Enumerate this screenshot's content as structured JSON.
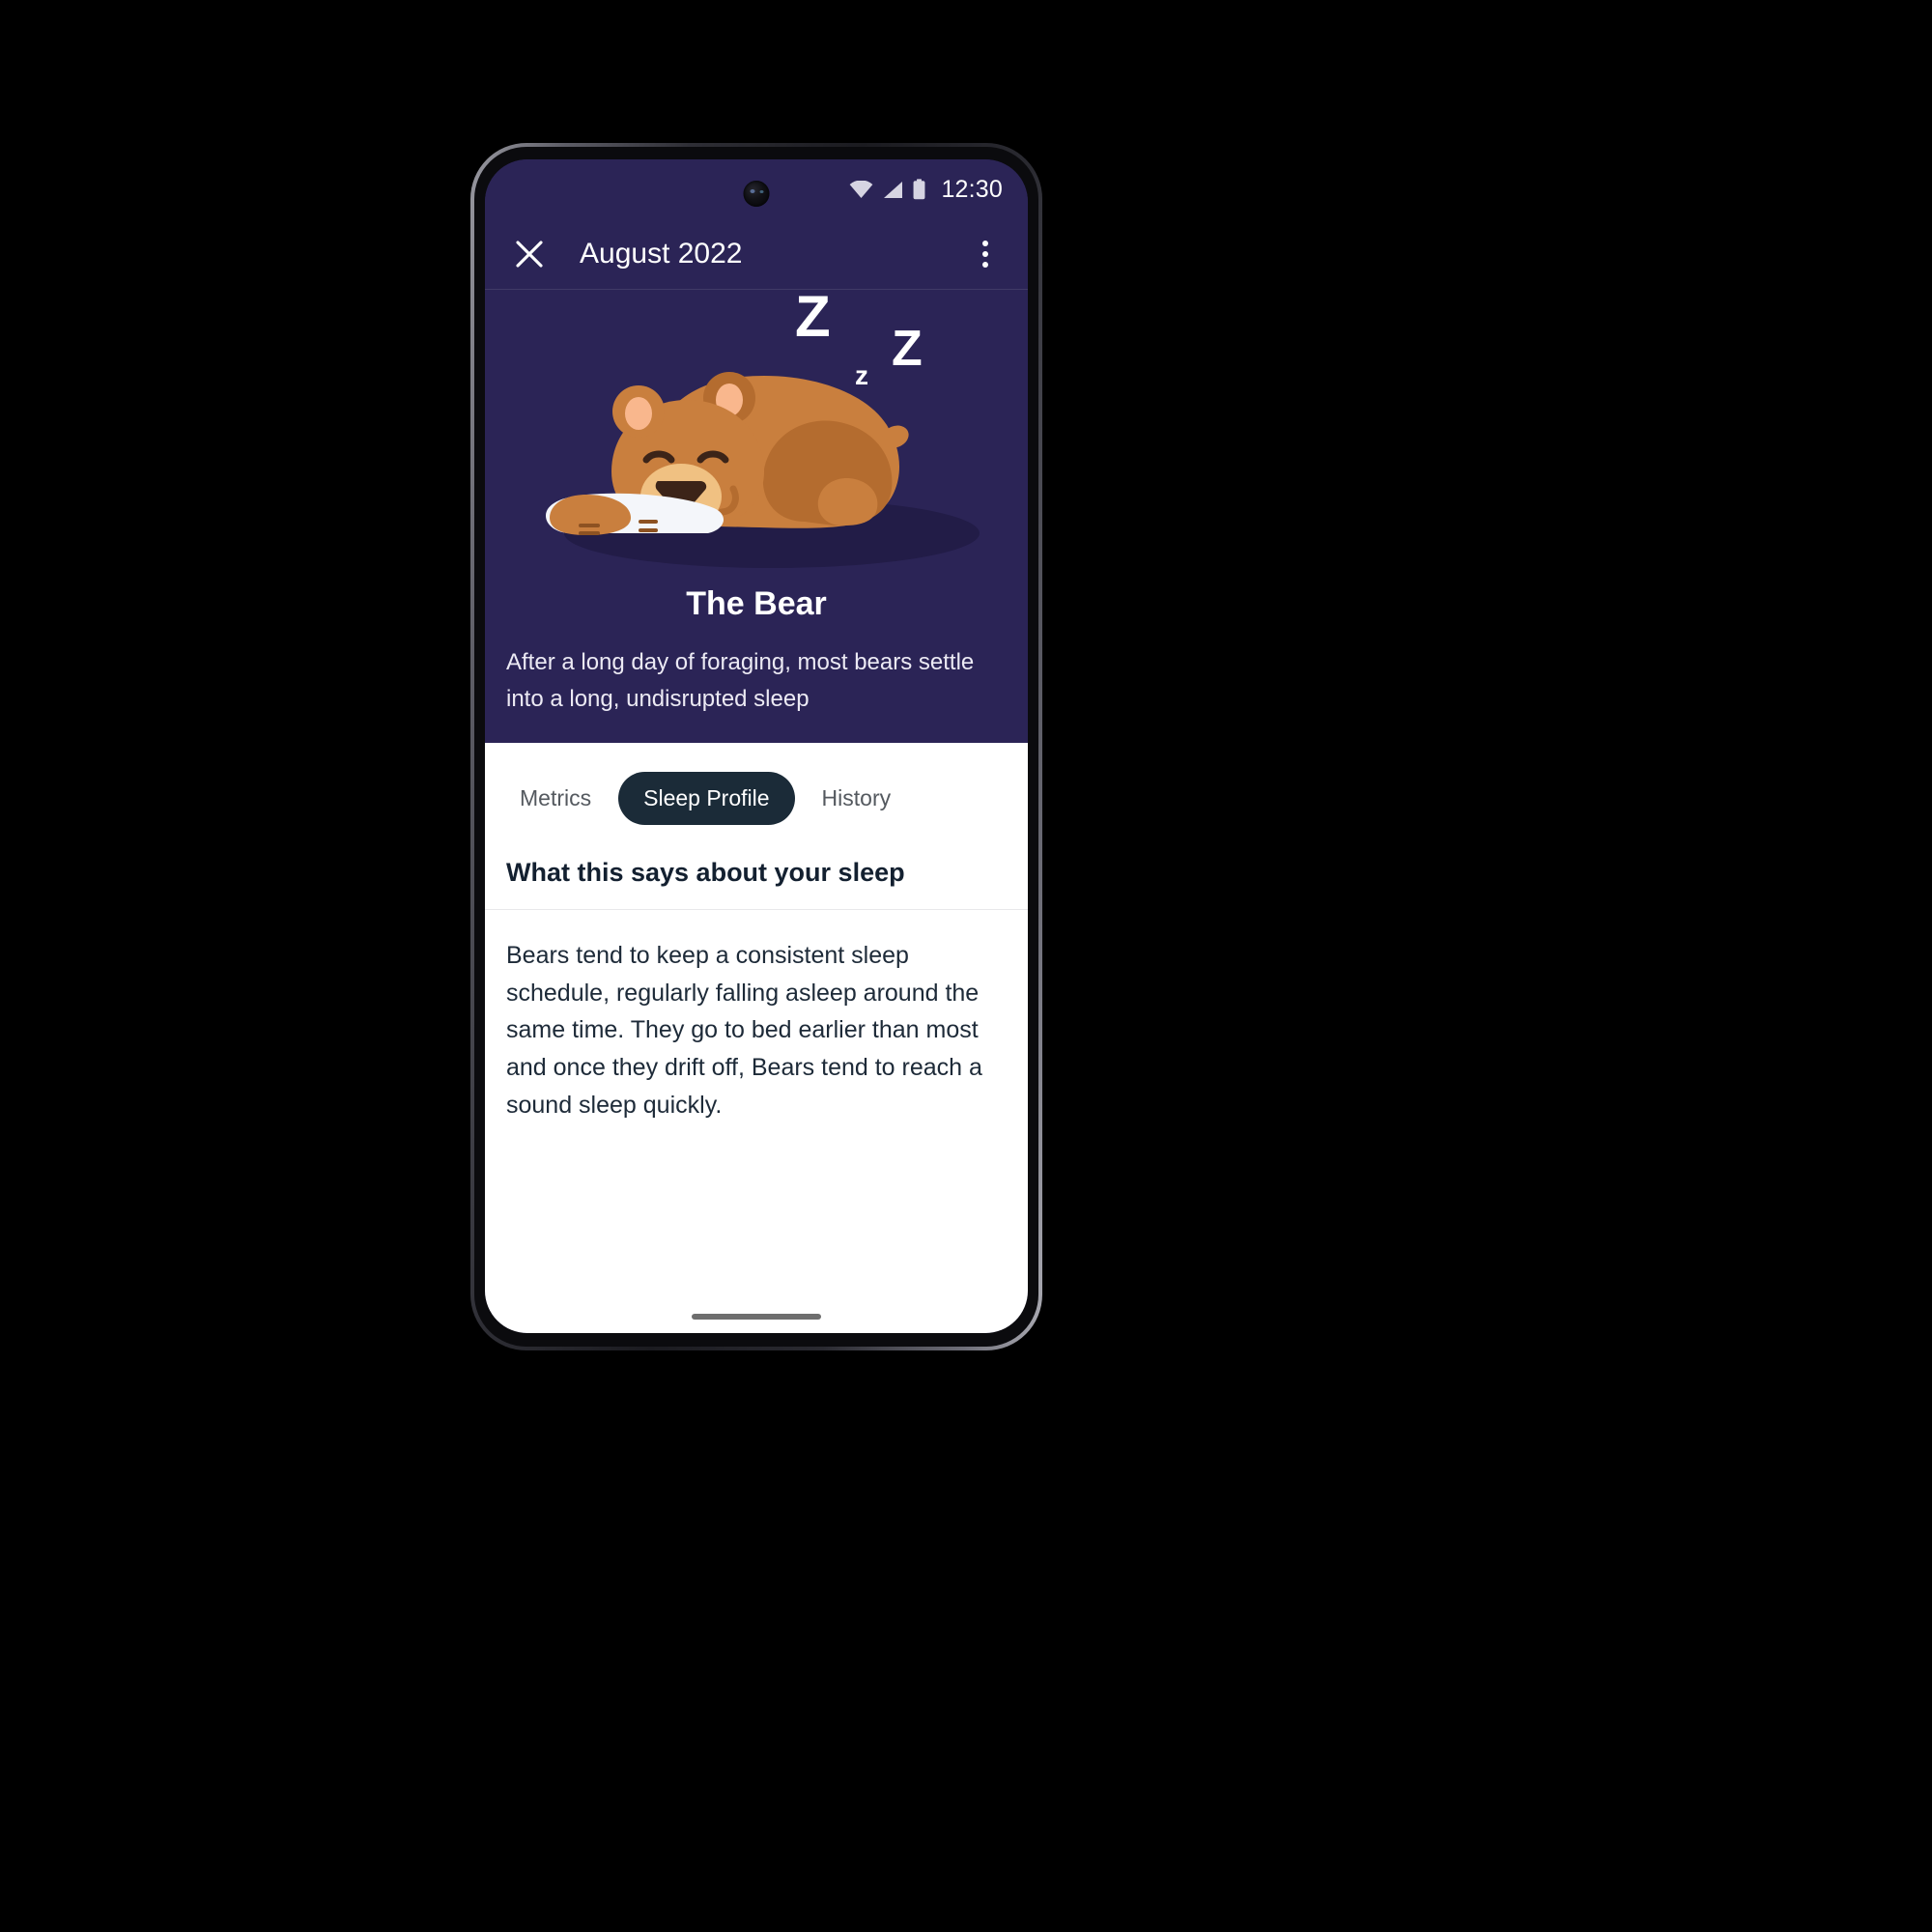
{
  "status_bar": {
    "time": "12:30",
    "icons": [
      "wifi-icon",
      "cellular-signal-icon",
      "battery-icon"
    ]
  },
  "app_bar": {
    "close_icon": "close-icon",
    "title": "August 2022",
    "overflow_icon": "more-vertical-icon"
  },
  "hero": {
    "illustration": "sleeping-bear-illustration",
    "sleep_marks": [
      "Z",
      "z",
      "Z"
    ],
    "title": "The Bear",
    "description": "After a long day of foraging, most bears settle into a long, undisrupted sleep",
    "background_color": "#2b2456"
  },
  "tabs": [
    {
      "label": "Metrics",
      "active": false
    },
    {
      "label": "Sleep Profile",
      "active": true
    },
    {
      "label": "History",
      "active": false
    }
  ],
  "content": {
    "section_title": "What this says about your sleep",
    "paragraph": "Bears tend to keep a consistent sleep schedule, regularly falling asleep around the same time. They go to bed earlier than most and once they drift off, Bears tend to reach a sound sleep quickly."
  },
  "colors": {
    "hero_background": "#2b2456",
    "active_tab": "#1b2b38",
    "sheet_background": "#ffffff",
    "heading_text": "#132030",
    "body_text": "#1d2a38",
    "inactive_tab_text": "#54595f",
    "bear_body": "#c97f3e",
    "bear_shade": "#b46c2f",
    "bear_ear_inner": "#f9b78d",
    "bear_muzzle": "#f0c182",
    "bear_nose": "#3c2418",
    "pillow": "#f4f6fa",
    "ground_shadow": "#221c47"
  },
  "home_indicator": "home-indicator"
}
